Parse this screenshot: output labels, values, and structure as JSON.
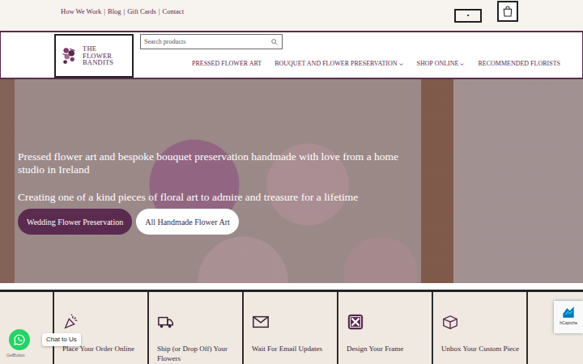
{
  "top_bar": {
    "links": [
      "How We Work",
      "Blog",
      "Gift Cards",
      "Contact"
    ],
    "separator": "|",
    "menu_dot": "•"
  },
  "header": {
    "logo_lines": [
      "THE",
      "FLOWER",
      "BANDITS"
    ],
    "search": {
      "placeholder": "Search products"
    },
    "nav": [
      {
        "label": "PRESSED FLOWER ART",
        "has_menu": false
      },
      {
        "label": "BOUQUET AND FLOWER PRESERVATION",
        "has_menu": true
      },
      {
        "label": "SHOP ONLINE",
        "has_menu": true
      },
      {
        "label": "RECOMMENDED FLORISTS",
        "has_menu": false
      }
    ]
  },
  "hero": {
    "headline": "Pressed flower art and bespoke bouquet preservation handmade with love from a home studio in Ireland",
    "subline": "Creating one of a kind pieces of floral art to admire and treasure for a lifetime",
    "buttons": [
      {
        "label": "Wedding Flower Preservation",
        "kind": "primary"
      },
      {
        "label": "All Handmade Flower Art",
        "kind": "light"
      }
    ]
  },
  "steps": [
    {
      "label": "Place Your Order Online"
    },
    {
      "label": "Ship (or Drop Off) Your Flowers"
    },
    {
      "label": "Wait For Email Updates"
    },
    {
      "label": "Design Your Frame"
    },
    {
      "label": "Unbox Your Custom Piece"
    }
  ],
  "chat_widget": {
    "label": "Chat to Us",
    "credit": "GetButton"
  },
  "captcha": {
    "label": "hCaptcha"
  }
}
